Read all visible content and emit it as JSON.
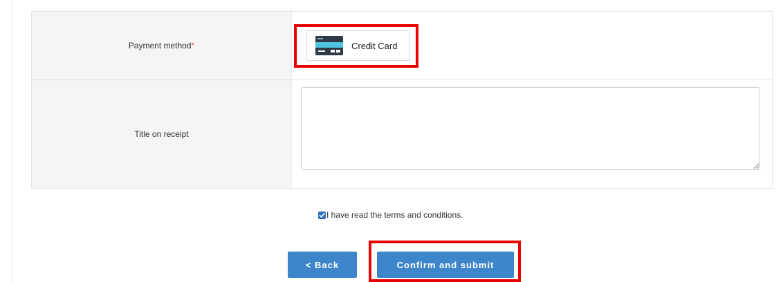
{
  "form": {
    "payment_label": "Payment method",
    "required_mark": "*",
    "payment_option_label": "Credit Card",
    "payment_icon": "credit-card-icon",
    "receipt_label": "Title on receipt",
    "receipt_value": ""
  },
  "terms": {
    "text": "I have read the terms and conditions.",
    "checked": true
  },
  "buttons": {
    "back_label": "< Back",
    "submit_label": "Confirm and submit"
  },
  "colors": {
    "button_bg": "#3e86cc",
    "highlight": "#e60000",
    "label_bg": "#f5f5f5",
    "checkbox": "#2f71c0"
  }
}
